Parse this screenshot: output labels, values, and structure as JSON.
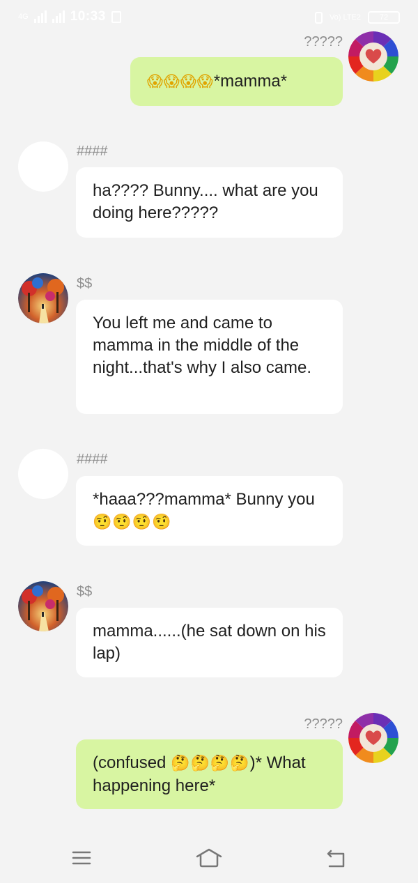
{
  "status_bar": {
    "network": "4G",
    "time": "10:33",
    "volte": "Vo) LTE2",
    "battery": "72"
  },
  "messages": [
    {
      "side": "right",
      "avatar": "pencil-heart-avatar",
      "sender": "?????",
      "text": "*mamma*",
      "emoji": "😱😱😱😱",
      "emoji_position": "before"
    },
    {
      "side": "left",
      "avatar": "blank-avatar",
      "sender": "####",
      "text": "ha???? Bunny.... what are you doing here?????"
    },
    {
      "side": "left",
      "avatar": "painted-forest-avatar",
      "sender": "$$",
      "text": "You left me and came to mamma in the middle of the night...that's why I also came."
    },
    {
      "side": "left",
      "avatar": "blank-avatar",
      "sender": "####",
      "text": "*haaa???mamma* Bunny you",
      "emoji": "🤨🤨🤨🤨",
      "emoji_position": "after"
    },
    {
      "side": "left",
      "avatar": "painted-forest-avatar",
      "sender": "$$",
      "text": "mamma......(he sat down on his lap)"
    },
    {
      "side": "right",
      "avatar": "pencil-heart-avatar",
      "sender": "?????",
      "text_before": "(confused ",
      "emoji": "🤔🤔🤔🤔",
      "text_after": ")* What happening here*"
    }
  ],
  "colors": {
    "background": "#f3f3f3",
    "outgoing_bubble": "#d8f5a2",
    "incoming_bubble": "#ffffff",
    "sender_label": "#8e8e8e",
    "nav_icon": "#777777"
  },
  "nav_bar": {
    "icons": [
      "menu-icon",
      "home-icon",
      "back-icon"
    ]
  }
}
